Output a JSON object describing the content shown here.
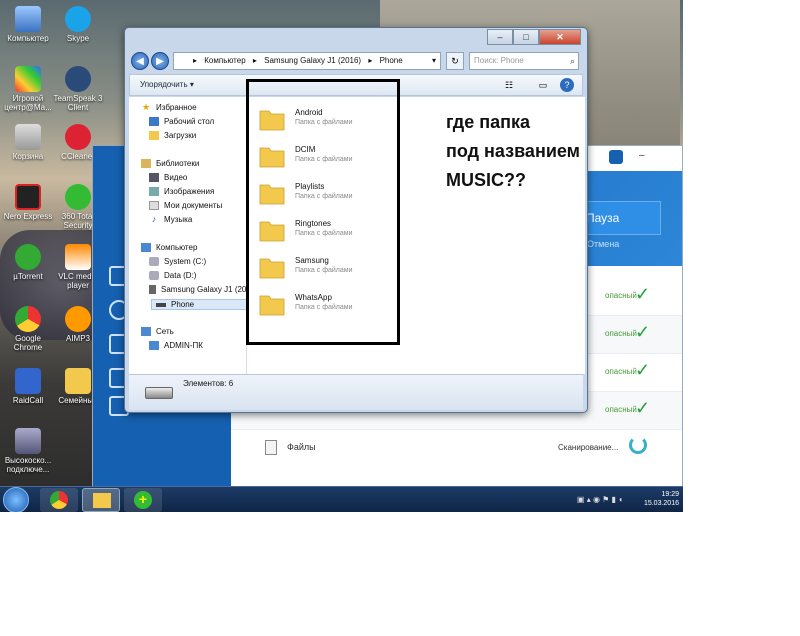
{
  "desktop": {
    "icons": [
      {
        "label": "Компьютер"
      },
      {
        "label": "Skype"
      },
      {
        "label": "Игровой центр@Ма..."
      },
      {
        "label": "TeamSpeak 3 Client"
      },
      {
        "label": "Корзина"
      },
      {
        "label": "CCleaner"
      },
      {
        "label": "Nero Express"
      },
      {
        "label": "360 Total Security"
      },
      {
        "label": "µTorrent"
      },
      {
        "label": "VLC media player"
      },
      {
        "label": "Google Chrome"
      },
      {
        "label": "AIMP3"
      },
      {
        "label": "RaidCall"
      },
      {
        "label": "Семейные"
      },
      {
        "label": "Высокоско... подключе..."
      }
    ]
  },
  "security_app": {
    "pause_label": "Пауза",
    "cancel_label": "Отмена",
    "status_safe": "опасный",
    "files_label": "Файлы",
    "scanning_label": "Сканирование..."
  },
  "explorer": {
    "address_parts": [
      "Компьютер",
      "Samsung Galaxy J1 (2016)",
      "Phone"
    ],
    "search_placeholder": "Поиск: Phone",
    "organize_label": "Упорядочить",
    "nav": {
      "favorites": "Избранное",
      "desktop": "Рабочий стол",
      "downloads": "Загрузки",
      "libraries": "Библиотеки",
      "video": "Видео",
      "images": "Изображения",
      "documents": "Мои документы",
      "music": "Музыка",
      "computer": "Компьютер",
      "system_c": "System (C:)",
      "data_d": "Data (D:)",
      "device": "Samsung Galaxy J1 (2016",
      "phone": "Phone",
      "network": "Сеть",
      "admin_pc": "ADMIN-ПК"
    },
    "folders": [
      {
        "name": "Android",
        "desc": "Папка с файлами"
      },
      {
        "name": "DCIM",
        "desc": "Папка с файлами"
      },
      {
        "name": "Playlists",
        "desc": "Папка с файлами"
      },
      {
        "name": "Ringtones",
        "desc": "Папка с файлами"
      },
      {
        "name": "Samsung",
        "desc": "Папка с файлами"
      },
      {
        "name": "WhatsApp",
        "desc": "Папка с файлами"
      }
    ],
    "items_count": "Элементов: 6"
  },
  "annotation": {
    "line1": "где папка",
    "line2": "под названием",
    "line3": "MUSIC??"
  },
  "taskbar": {
    "time": "19:29",
    "date": "15.03.2016"
  },
  "colors": {
    "folder": "#f2c94c",
    "app_blue": "#1560b0",
    "taskbar": "#1d3b66"
  }
}
